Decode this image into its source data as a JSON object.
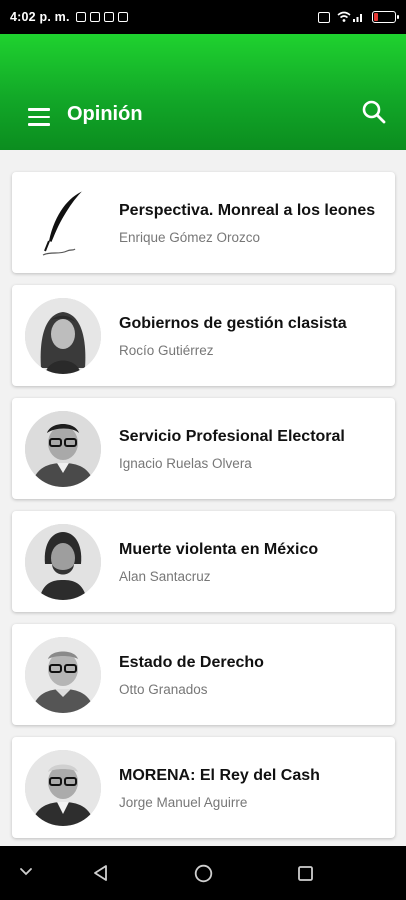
{
  "status_bar": {
    "time": "4:02 p. m.",
    "battery_level": 0.2,
    "battery_color": "#e53935"
  },
  "app_bar": {
    "title": "Opinión",
    "menu_icon": "hamburger-menu-icon",
    "search_icon": "search-icon",
    "gradient_top": "#1fd22f",
    "gradient_bottom": "#0b8d1f"
  },
  "articles": [
    {
      "title": "Perspectiva. Monreal a los leones",
      "author": "Enrique Gómez Orozco",
      "image": "quill-icon"
    },
    {
      "title": "Gobiernos de gestión clasista",
      "author": "Rocío Gutiérrez",
      "image": "author-photo"
    },
    {
      "title": "Servicio Profesional Electoral",
      "author": "Ignacio Ruelas Olvera",
      "image": "author-photo"
    },
    {
      "title": "Muerte violenta en México",
      "author": "Alan Santacruz",
      "image": "author-photo"
    },
    {
      "title": "Estado de Derecho",
      "author": "Otto Granados",
      "image": "author-photo"
    },
    {
      "title": "MORENA: El Rey del Cash",
      "author": "Jorge Manuel Aguirre",
      "image": "author-photo"
    }
  ],
  "nav_bar": {
    "icons": [
      "chevron-down-icon",
      "back-triangle-icon",
      "home-circle-icon",
      "recents-square-icon"
    ]
  }
}
